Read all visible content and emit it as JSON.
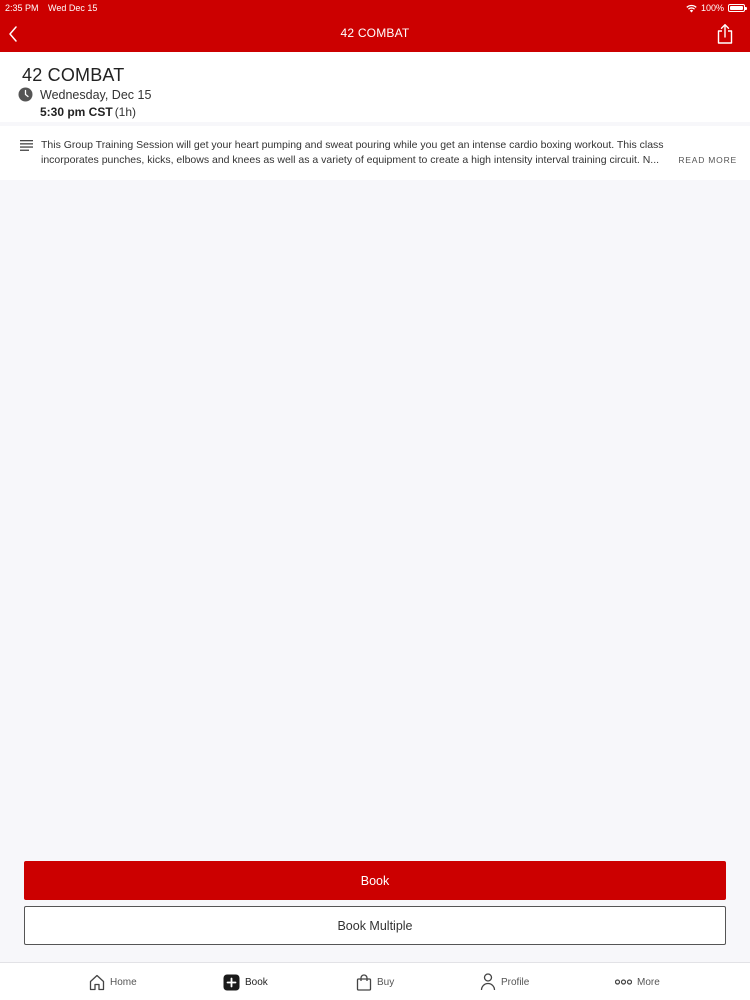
{
  "status_bar": {
    "time": "2:35 PM",
    "date": "Wed Dec 15",
    "battery": "100%",
    "icons": [
      "wifi-icon",
      "battery-icon"
    ]
  },
  "nav": {
    "title": "42 COMBAT",
    "icons": [
      "chevron-left-icon",
      "share-icon"
    ]
  },
  "class": {
    "title": "42 COMBAT",
    "date": "Wednesday, Dec 15",
    "time": "5:30 pm CST",
    "duration": "(1h)",
    "icon": "clock-icon"
  },
  "description": {
    "text": "This Group Training Session will get your heart pumping and sweat pouring while you get an intense cardio boxing workout. This class incorporates punches, kicks, elbows and knees as well as a variety of equipment to create a high intensity interval training circuit. N...",
    "read_more": "READ MORE",
    "icon": "lines-icon"
  },
  "actions": {
    "book": "Book",
    "book_multiple": "Book Multiple"
  },
  "tabs": [
    {
      "label": "Home",
      "icon": "home-icon"
    },
    {
      "label": "Book",
      "icon": "plus-square-icon",
      "active": true
    },
    {
      "label": "Buy",
      "icon": "shopping-bag-icon"
    },
    {
      "label": "Profile",
      "icon": "person-icon"
    },
    {
      "label": "More",
      "icon": "more-dots-icon"
    }
  ],
  "colors": {
    "brand": "#cc0000",
    "background": "#f7f7fa"
  }
}
